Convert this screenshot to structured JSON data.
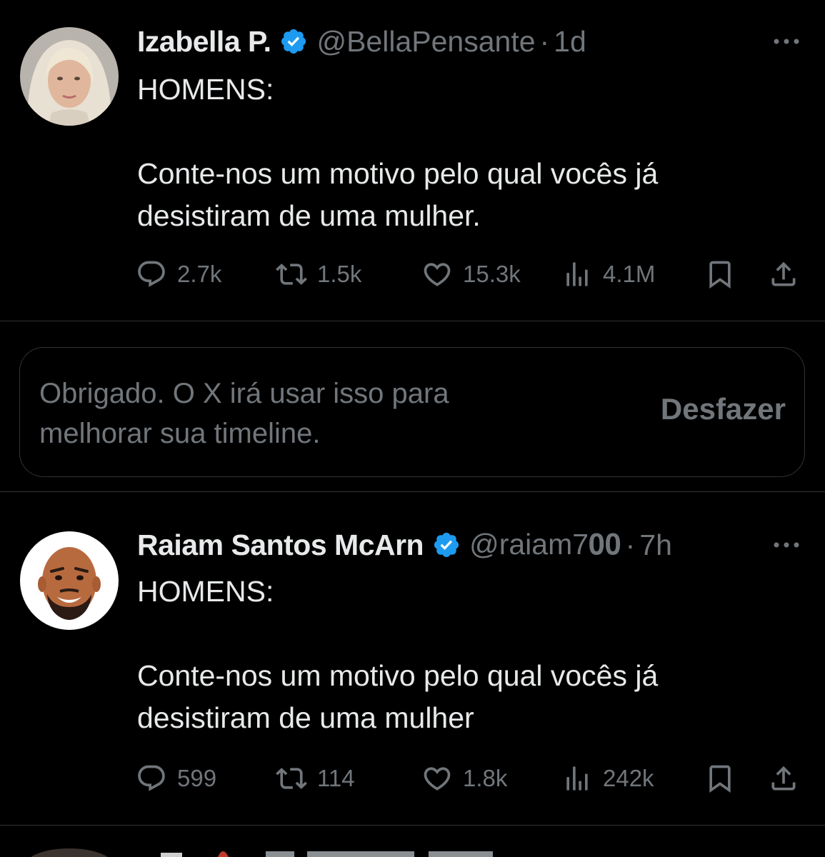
{
  "tweets": [
    {
      "display_name": "Izabella P.",
      "handle": "@BellaPensante",
      "separator": "·",
      "time": "1d",
      "text_lines": [
        "HOMENS:",
        "",
        "Conte-nos um motivo pelo qual vocês já",
        "desistiram de uma mulher."
      ],
      "replies": "2.7k",
      "reposts": "1.5k",
      "likes": "15.3k",
      "views": "4.1M"
    },
    {
      "display_name": "Raiam Santos McArn",
      "handle": "@raiam7𝟎𝟎",
      "separator": "·",
      "time": "7h",
      "text_lines": [
        "HOMENS:",
        "",
        "Conte-nos um motivo pelo qual vocês já",
        "desistiram de uma mulher"
      ],
      "replies": "599",
      "reposts": "114",
      "likes": "1.8k",
      "views": "242k"
    }
  ],
  "feedback": {
    "message_line1": "Obrigado. O X irá usar isso para",
    "message_line2": "melhorar sua timeline.",
    "undo_label": "Desfazer"
  },
  "colors": {
    "background": "#000000",
    "text_primary": "#e7e9ea",
    "text_secondary": "#71767b",
    "divider": "#2f3336",
    "verified_blue": "#1d9bf0"
  },
  "icons": {
    "reply": "reply-icon",
    "repost": "repost-icon",
    "like": "heart-icon",
    "views": "views-icon",
    "bookmark": "bookmark-icon",
    "share": "share-icon",
    "more": "more-icon",
    "verified": "verified-badge-icon"
  }
}
